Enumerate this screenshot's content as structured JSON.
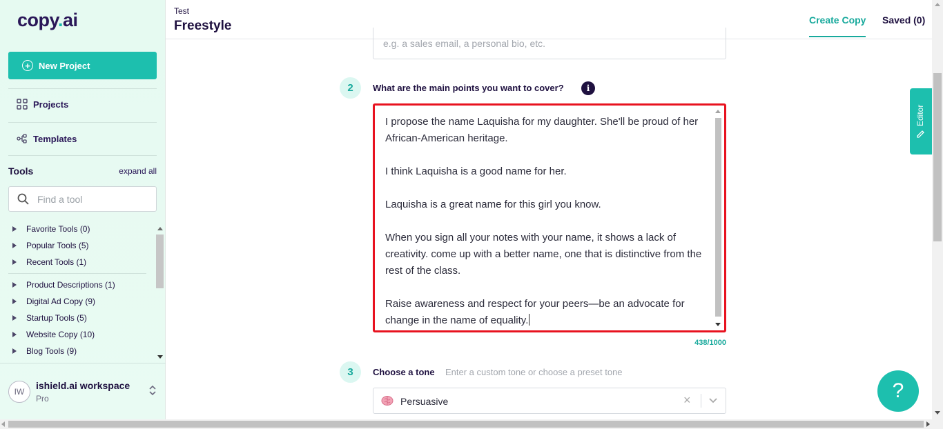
{
  "sidebar": {
    "logo_main": "copy",
    "logo_dot": ".",
    "logo_tail": "ai",
    "new_project": "New Project",
    "nav": [
      {
        "label": "Projects",
        "icon": "grid-icon"
      },
      {
        "label": "Templates",
        "icon": "templates-icon"
      }
    ],
    "tools_title": "Tools",
    "expand_all": "expand all",
    "search_placeholder": "Find a tool",
    "tool_groups": [
      "Favorite Tools (0)",
      "Popular Tools (5)",
      "Recent Tools (1)",
      "Product Descriptions (1)",
      "Digital Ad Copy (9)",
      "Startup Tools (5)",
      "Website Copy (10)",
      "Blog Tools (9)"
    ],
    "workspace": {
      "initials": "IW",
      "name": "ishield.ai workspace",
      "plan": "Pro"
    }
  },
  "header": {
    "breadcrumb": "Test",
    "title": "Freestyle",
    "tabs": [
      "Create Copy",
      "Saved (0)"
    ],
    "active_tab": "Create Copy"
  },
  "form": {
    "type_placeholder": "e.g. a sales email, a personal bio, etc.",
    "step2": {
      "number": "2",
      "label": "What are the main points you want to cover?",
      "info": "i",
      "paragraphs": [
        "I propose the name Laquisha for my daughter. She'll be proud of her African-American heritage.",
        "I think Laquisha is a good name for her.",
        "Laquisha is a great name for this girl you know.",
        "When you sign all your notes with your name, it shows a lack of creativity. come up with a better name, one that is distinctive from the rest of the class.",
        "Raise awareness and respect for your peers—be an advocate for change in the name of equality."
      ],
      "char_count": "438/1000"
    },
    "step3": {
      "number": "3",
      "label": "Choose a tone",
      "hint": "Enter a custom tone or choose a preset tone",
      "selected_tone": "Persuasive",
      "tone_icon": "brain-icon"
    }
  },
  "editor_tab": "Editor",
  "help_label": "?",
  "colors": {
    "accent": "#1dbfae",
    "accent_dark": "#17a99c",
    "highlight_border": "#e8121f",
    "text_dark": "#1f1140",
    "sidebar_bg": "#e6faf1"
  }
}
